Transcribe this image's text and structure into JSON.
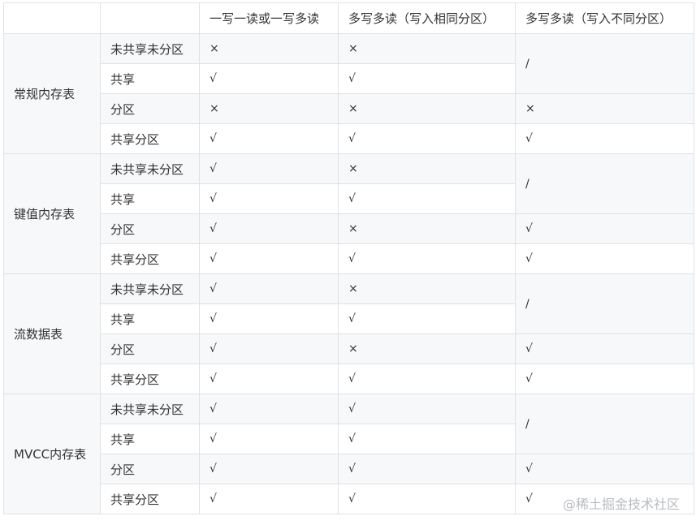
{
  "headers": [
    "",
    "",
    "一写一读或一写多读",
    "多写多读（写入相同分区）",
    "多写多读（写入不同分区）"
  ],
  "groups": [
    {
      "name": "常规内存表",
      "rows": [
        {
          "type": "未共享未分区",
          "c1": "×",
          "c2": "×",
          "c3": "/"
        },
        {
          "type": "共享",
          "c1": "√",
          "c2": "√",
          "c3": null
        },
        {
          "type": "分区",
          "c1": "×",
          "c2": "×",
          "c3": "×"
        },
        {
          "type": "共享分区",
          "c1": "√",
          "c2": "√",
          "c3": "√"
        }
      ]
    },
    {
      "name": "键值内存表",
      "rows": [
        {
          "type": "未共享未分区",
          "c1": "√",
          "c2": "×",
          "c3": "/"
        },
        {
          "type": "共享",
          "c1": "√",
          "c2": "√",
          "c3": null
        },
        {
          "type": "分区",
          "c1": "√",
          "c2": "×",
          "c3": "√"
        },
        {
          "type": "共享分区",
          "c1": "√",
          "c2": "√",
          "c3": "√"
        }
      ]
    },
    {
      "name": "流数据表",
      "rows": [
        {
          "type": "未共享未分区",
          "c1": "√",
          "c2": "×",
          "c3": "/"
        },
        {
          "type": "共享",
          "c1": "√",
          "c2": "√",
          "c3": null
        },
        {
          "type": "分区",
          "c1": "√",
          "c2": "×",
          "c3": "√"
        },
        {
          "type": "共享分区",
          "c1": "√",
          "c2": "√",
          "c3": "√"
        }
      ]
    },
    {
      "name": "MVCC内存表",
      "rows": [
        {
          "type": "未共享未分区",
          "c1": "√",
          "c2": "√",
          "c3": "/"
        },
        {
          "type": "共享",
          "c1": "√",
          "c2": "√",
          "c3": null
        },
        {
          "type": "分区",
          "c1": "√",
          "c2": "√",
          "c3": "√"
        },
        {
          "type": "共享分区",
          "c1": "√",
          "c2": "√",
          "c3": "√"
        }
      ]
    }
  ],
  "watermark": "@稀土掘金技术社区"
}
